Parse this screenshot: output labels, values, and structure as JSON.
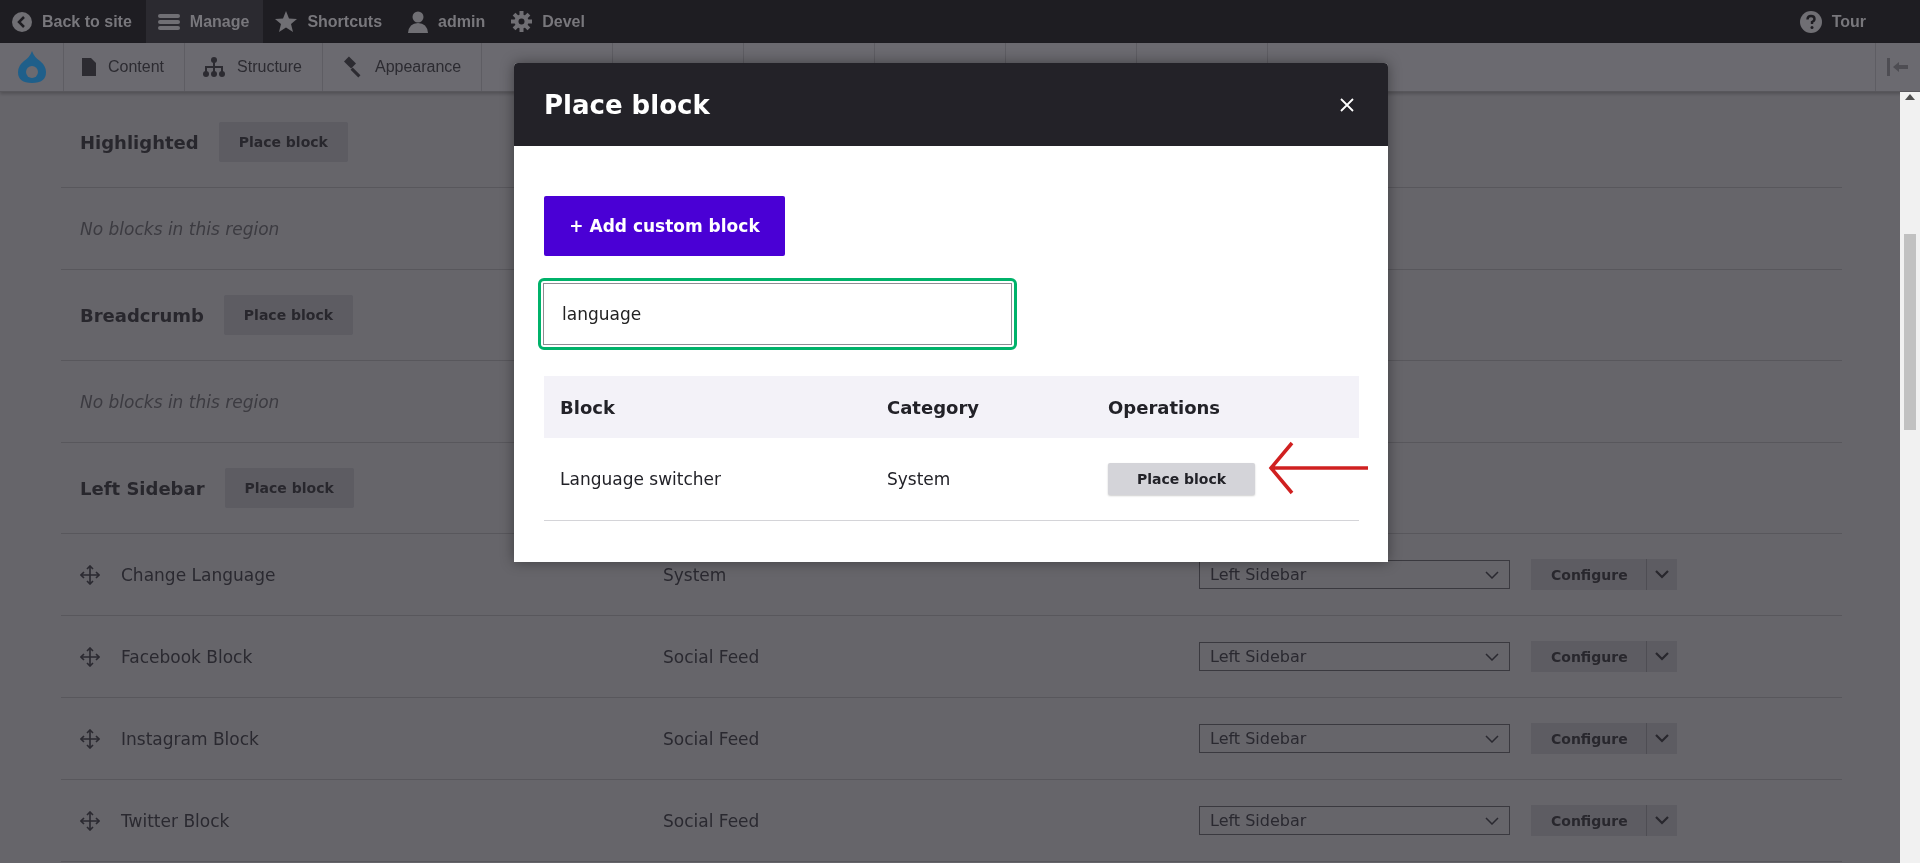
{
  "toolbar": {
    "items": [
      {
        "label": "Back to site",
        "selected": false
      },
      {
        "label": "Manage",
        "selected": true
      },
      {
        "label": "Shortcuts",
        "selected": false
      },
      {
        "label": "admin",
        "selected": false
      },
      {
        "label": "Devel",
        "selected": false
      }
    ],
    "tour": "Tour"
  },
  "tray": {
    "items": [
      "Content",
      "Structure",
      "Appearance"
    ]
  },
  "regions": [
    {
      "title": "Highlighted",
      "button": "Place block",
      "empty_message": "No blocks in this region"
    },
    {
      "title": "Breadcrumb",
      "button": "Place block",
      "empty_message": "No blocks in this region"
    },
    {
      "title": "Left Sidebar",
      "button": "Place block",
      "blocks": [
        {
          "name": "Change Language",
          "category": "System",
          "region": "Left Sidebar",
          "action": "Configure"
        },
        {
          "name": "Facebook Block",
          "category": "Social Feed",
          "region": "Left Sidebar",
          "action": "Configure"
        },
        {
          "name": "Instagram Block",
          "category": "Social Feed",
          "region": "Left Sidebar",
          "action": "Configure"
        },
        {
          "name": "Twitter Block",
          "category": "Social Feed",
          "region": "Left Sidebar",
          "action": "Configure"
        }
      ]
    }
  ],
  "modal": {
    "title": "Place block",
    "add_button": "+ Add custom block",
    "search": {
      "value": "language"
    },
    "table": {
      "columns": [
        "Block",
        "Category",
        "Operations"
      ],
      "rows": [
        {
          "block": "Language switcher",
          "category": "System",
          "action": "Place block"
        }
      ]
    }
  }
}
